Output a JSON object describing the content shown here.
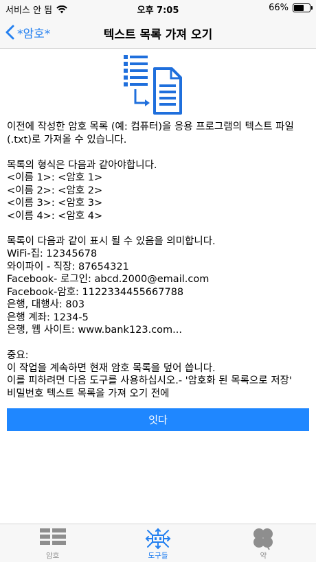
{
  "status_bar": {
    "carrier": "서비스 안 됨",
    "time": "오후 7:05",
    "battery": "66%",
    "battery_level": 0.66
  },
  "nav": {
    "back_label": "*암호*",
    "title": "텍스트 목록 가져 오기"
  },
  "hero_icon": "list-to-document-icon",
  "body": {
    "intro": "이전에 작성한 암호 목록 (예: 컴퓨터)을 응용 프로그램의 텍스트 파일 (.txt)로 가져올 수 있습니다.",
    "format_heading": "목록의 형식은 다음과 같아야합니다.",
    "format_lines": [
      "<이름 1>: <암호 1>",
      "<이름 2>: <암호 2>",
      "<이름 3>: <암호 3>",
      "<이름 4>: <암호 4>"
    ],
    "example_heading": "목록이 다음과 같이 표시 될 수 있음을 의미합니다.",
    "example_lines": [
      "WiFi-집: 12345678",
      "와이파이 - 직장: 87654321",
      "Facebook- 로그인: abcd.2000@email.com",
      "Facebook-암호: 1122334455667788",
      "은행, 대행사: 803",
      "은행 계좌: 1234-5",
      "은행, 웹 사이트: www.bank123.com..."
    ],
    "warning_heading": "중요:",
    "warning_lines": [
      "이 작업을 계속하면 현재 암호 목록을 덮어 씁니다.",
      "이를 피하려면 다음 도구를 사용하십시오.- '암호화 된 목록으로 저장'",
      "비밀번호 텍스트 목록을 가져 오기 전에"
    ]
  },
  "action_button": "잇다",
  "tabs": [
    {
      "label": "암호",
      "icon": "list-icon",
      "active": false
    },
    {
      "label": "도구들",
      "icon": "tools-icon",
      "active": true
    },
    {
      "label": "약",
      "icon": "clover-icon",
      "active": false
    }
  ],
  "colors": {
    "accent": "#2480f0",
    "button": "#1f87ff",
    "tab_inactive": "#8e8e8e"
  }
}
